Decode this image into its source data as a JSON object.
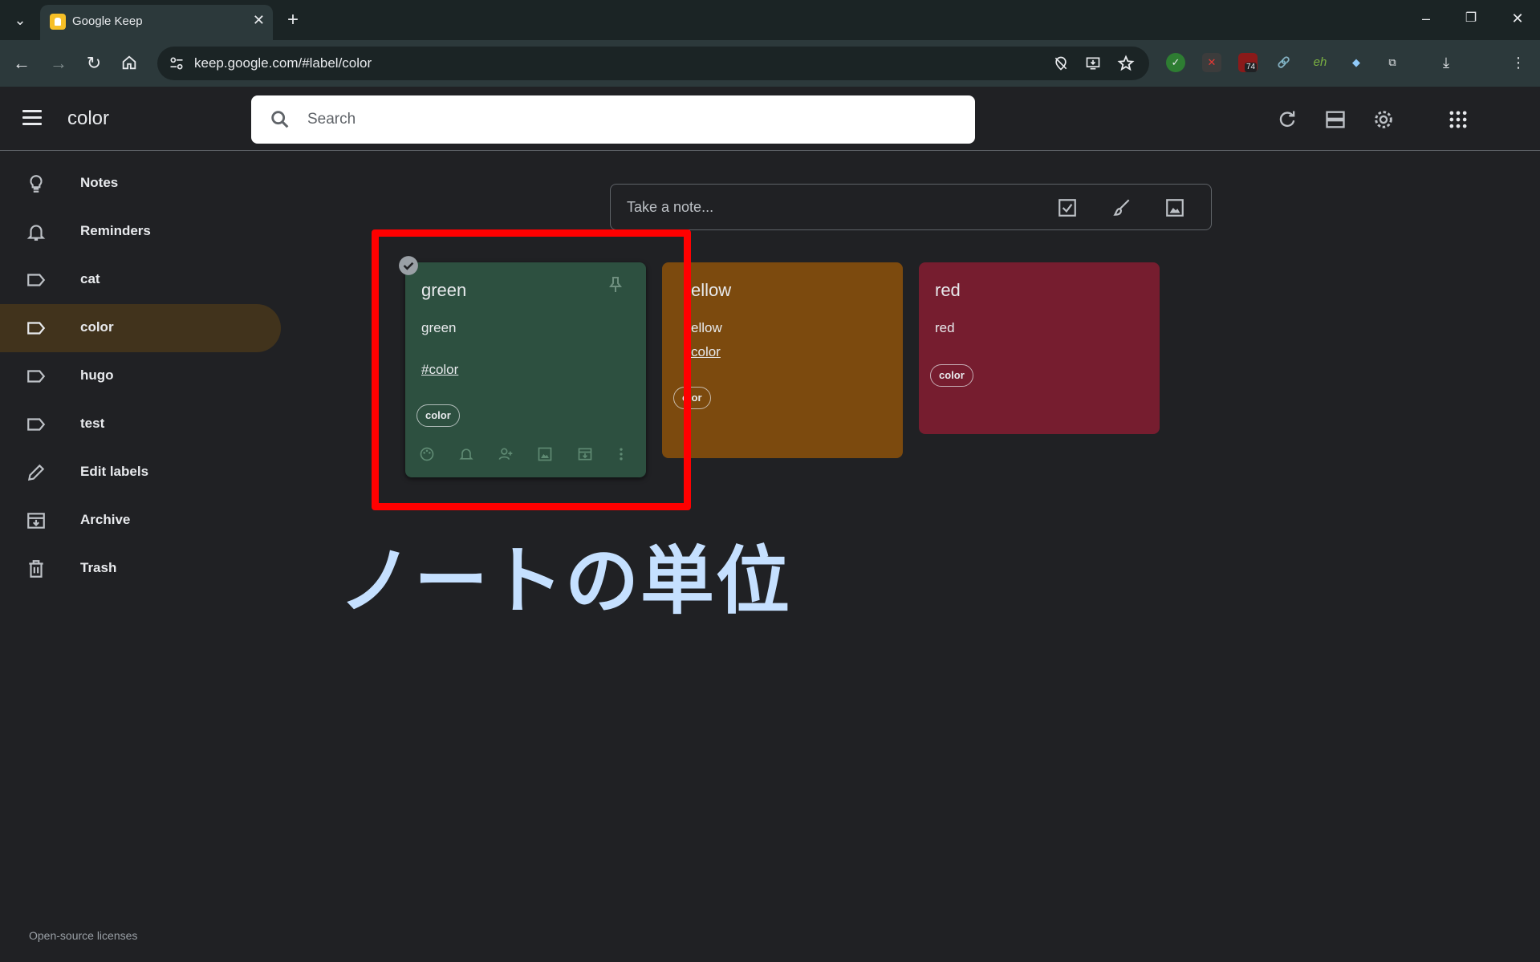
{
  "browser": {
    "tab_title": "Google Keep",
    "url": "keep.google.com/#label/color",
    "extension_badge": "74"
  },
  "header": {
    "label_title": "color",
    "search_placeholder": "Search"
  },
  "sidebar": {
    "items": [
      {
        "label": "Notes",
        "icon": "lightbulb-icon"
      },
      {
        "label": "Reminders",
        "icon": "bell-icon"
      },
      {
        "label": "cat",
        "icon": "label-icon"
      },
      {
        "label": "color",
        "icon": "label-icon",
        "active": true
      },
      {
        "label": "hugo",
        "icon": "label-icon"
      },
      {
        "label": "test",
        "icon": "label-icon"
      },
      {
        "label": "Edit labels",
        "icon": "pencil-icon"
      },
      {
        "label": "Archive",
        "icon": "archive-icon"
      },
      {
        "label": "Trash",
        "icon": "trash-icon"
      }
    ]
  },
  "take_note": {
    "placeholder": "Take a note..."
  },
  "notes": [
    {
      "title": "green",
      "body": "green",
      "hashtag": "#color",
      "label": "color",
      "color": "#2d5040"
    },
    {
      "title": "ellow",
      "body": "ellow",
      "hashtag": "color",
      "label": "olor",
      "color": "#7c4a0e"
    },
    {
      "title": "red",
      "body": "red",
      "label": "color",
      "color": "#761d2f"
    }
  ],
  "annotation": "ノートの単位",
  "footer": {
    "licenses": "Open-source licenses"
  },
  "colors": {
    "accent_active": "#41331c",
    "highlight": "#ff0000"
  }
}
